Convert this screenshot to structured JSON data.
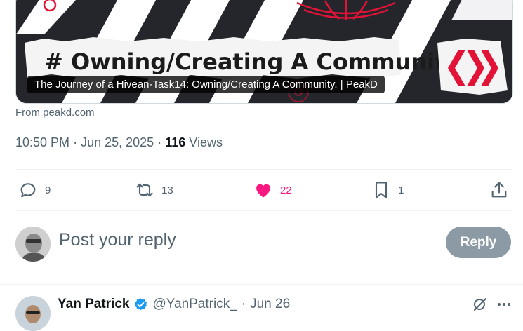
{
  "link_card": {
    "title_overlay": "The Journey of a Hivean-Task14: Owning/Creating A Community. | PeakD",
    "image_headline": "# Owning/Creating A Community",
    "source": "From peakd.com",
    "colors": {
      "hive_red": "#e31337"
    }
  },
  "tweet_meta": {
    "time": "10:50 PM",
    "date": "Jun 25, 2025",
    "views_count": "116",
    "views_label": "Views"
  },
  "actions": {
    "replies": "9",
    "reposts": "13",
    "likes": "22",
    "bookmarks": "1",
    "like_color": "#f91880"
  },
  "composer": {
    "placeholder": "Post your reply",
    "button_label": "Reply"
  },
  "reply": {
    "author_name": "Yan Patrick",
    "handle": "@YanPatrick_",
    "separator": "·",
    "date": "Jun 26"
  }
}
